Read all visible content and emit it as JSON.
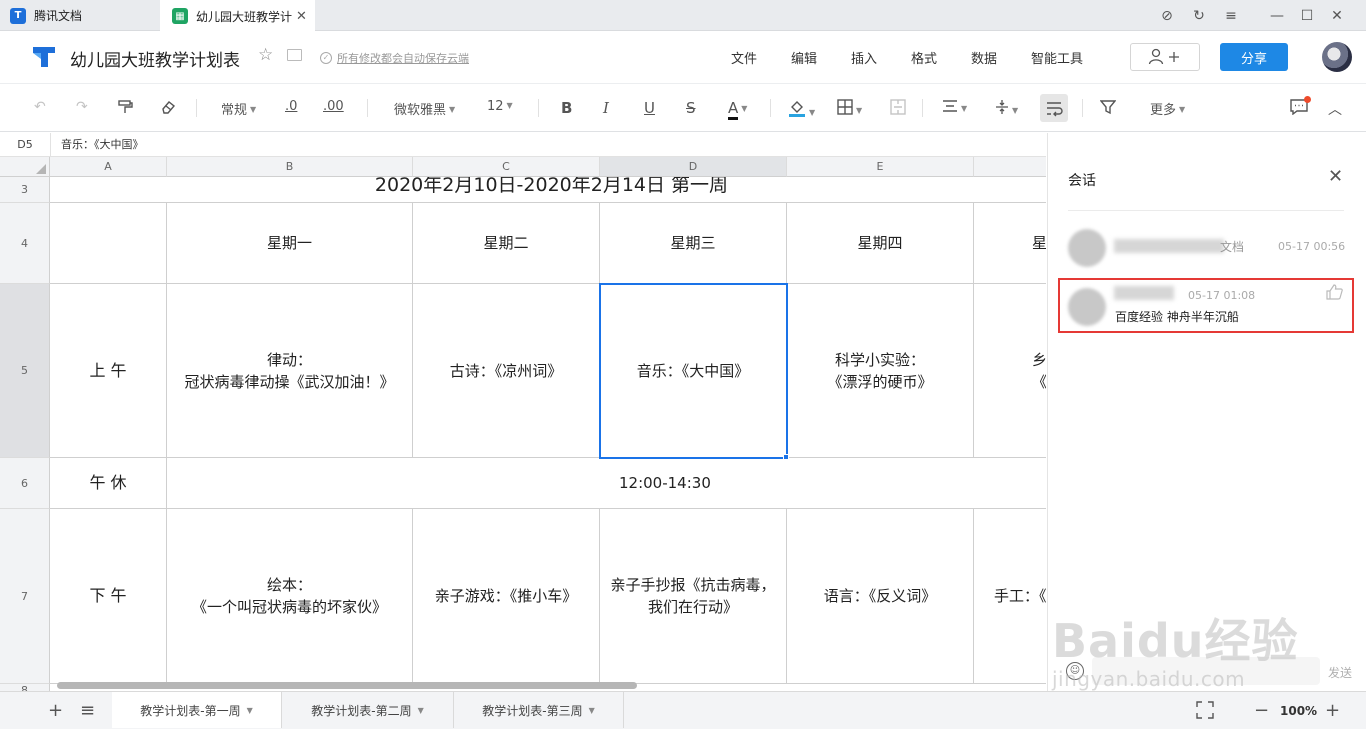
{
  "window": {
    "tabs": [
      {
        "label": "腾讯文档",
        "logo": "T"
      },
      {
        "label": "幼儿园大班教学计",
        "close": "✕"
      }
    ],
    "controls": [
      "⊘",
      "↻",
      "≡",
      "—",
      "☐",
      "✕"
    ]
  },
  "header": {
    "title": "幼儿园大班教学计划表",
    "save_status": "所有修改都会自动保存云端",
    "menus": [
      "文件",
      "编辑",
      "插入",
      "格式",
      "数据",
      "智能工具"
    ],
    "share_label": "分享"
  },
  "toolbar": {
    "format": "常规",
    "decrease_decimal": ".0",
    "increase_decimal": ".00",
    "font": "微软雅黑",
    "font_size": "12",
    "more": "更多"
  },
  "formula_bar": {
    "cell_ref": "D5",
    "content": "音乐：《大中国》"
  },
  "grid": {
    "columns": [
      "A",
      "B",
      "C",
      "D",
      "E"
    ],
    "selected_column": "D",
    "rows": [
      "3",
      "4",
      "5",
      "6",
      "7",
      "8"
    ],
    "selected_row": "5",
    "title_row": "2020年2月10日-2020年2月14日         第一周",
    "weekdays": [
      "星期一",
      "星期二",
      "星期三",
      "星期四",
      "星"
    ],
    "row5": {
      "label": "上 午",
      "cells": [
        "律动：\n冠状病毒律动操《武汉加油！》",
        "古诗：《凉州词》",
        "音乐：《大中国》",
        "科学小实验：\n《漂浮的硬币》",
        "乡\n《浴"
      ]
    },
    "row6": {
      "label": "午 休",
      "merged": "12:00-14:30"
    },
    "row7": {
      "label": "下 午",
      "cells": [
        "绘本：\n《一个叫冠状病毒的坏家伙》",
        "亲子游戏：《推小车》",
        "亲子手抄报《抗击病毒，\n我们在行动》",
        "语言：《反义词》",
        "手工：《"
      ]
    }
  },
  "sheets": {
    "tabs": [
      "教学计划表-第一周",
      "教学计划表-第二周",
      "教学计划表-第三周"
    ],
    "active": 0,
    "zoom": "100%"
  },
  "panel": {
    "title": "会话",
    "comments": [
      {
        "name_tail": "文档",
        "time": "05-17 00:56"
      },
      {
        "time": "05-17 01:08",
        "text": "百度经验 神舟半年沉船"
      }
    ],
    "send_label": "发送"
  },
  "watermark": {
    "main": "Baidu经验",
    "sub": "jingyan.baidu.com"
  },
  "colors": {
    "accent": "#1e88e5",
    "selection": "#1a73e8",
    "highlight_box": "#e53935"
  }
}
